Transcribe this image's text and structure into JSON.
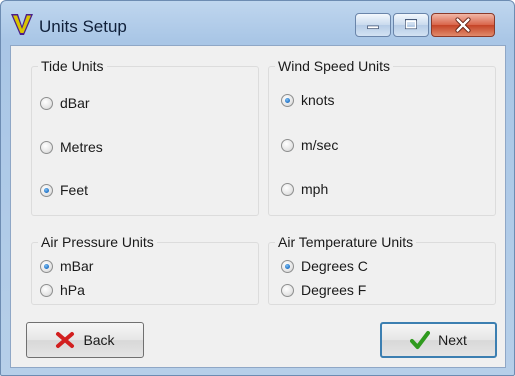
{
  "window": {
    "title": "Units Setup"
  },
  "groups": {
    "tide": {
      "title": "Tide Units",
      "options": [
        "dBar",
        "Metres",
        "Feet"
      ],
      "selected": "Feet"
    },
    "wind": {
      "title": "Wind Speed Units",
      "options": [
        "knots",
        "m/sec",
        "mph"
      ],
      "selected": "knots"
    },
    "pressure": {
      "title": "Air Pressure Units",
      "options": [
        "mBar",
        "hPa"
      ],
      "selected": "mBar"
    },
    "temperature": {
      "title": "Air Temperature Units",
      "options": [
        "Degrees C",
        "Degrees F"
      ],
      "selected": "Degrees C"
    }
  },
  "buttons": {
    "back_label": "Back",
    "next_label": "Next"
  },
  "icons": {
    "app": "app-logo-icon",
    "back": "red-x-icon",
    "next": "green-check-icon"
  },
  "colors": {
    "radio_selected": "#1e6fc4",
    "back_icon": "#d21f1f",
    "next_icon": "#2f9a1e",
    "default_button_border": "#3c7fb1"
  }
}
